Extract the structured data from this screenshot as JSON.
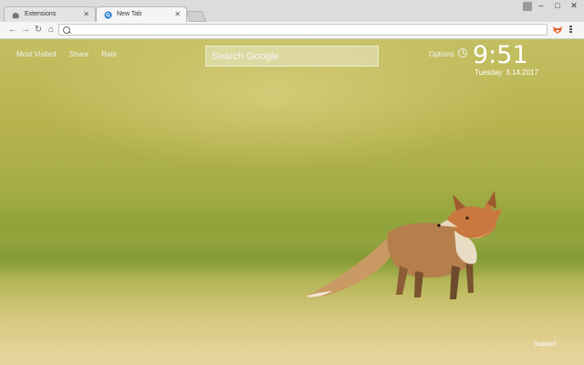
{
  "browser": {
    "tabs": [
      {
        "label": "Extensions",
        "icon": "puzzle-icon",
        "active": false
      },
      {
        "label": "New Tab",
        "icon": "search-icon",
        "active": true
      }
    ],
    "window_controls": [
      "–",
      "□",
      "✕"
    ]
  },
  "toolbar": {
    "address_value": ""
  },
  "newtab": {
    "links": [
      "Most Visited",
      "Share",
      "Rate"
    ],
    "search_placeholder": "Search Google",
    "options_label": "Options",
    "time": "9:51",
    "date_day": "Tuesday",
    "date_value": "3.14.2017",
    "support_label": "Support"
  },
  "colors": {
    "accent_tab_icon": "#2d7fd3",
    "extension_icon": "#e8632a"
  }
}
